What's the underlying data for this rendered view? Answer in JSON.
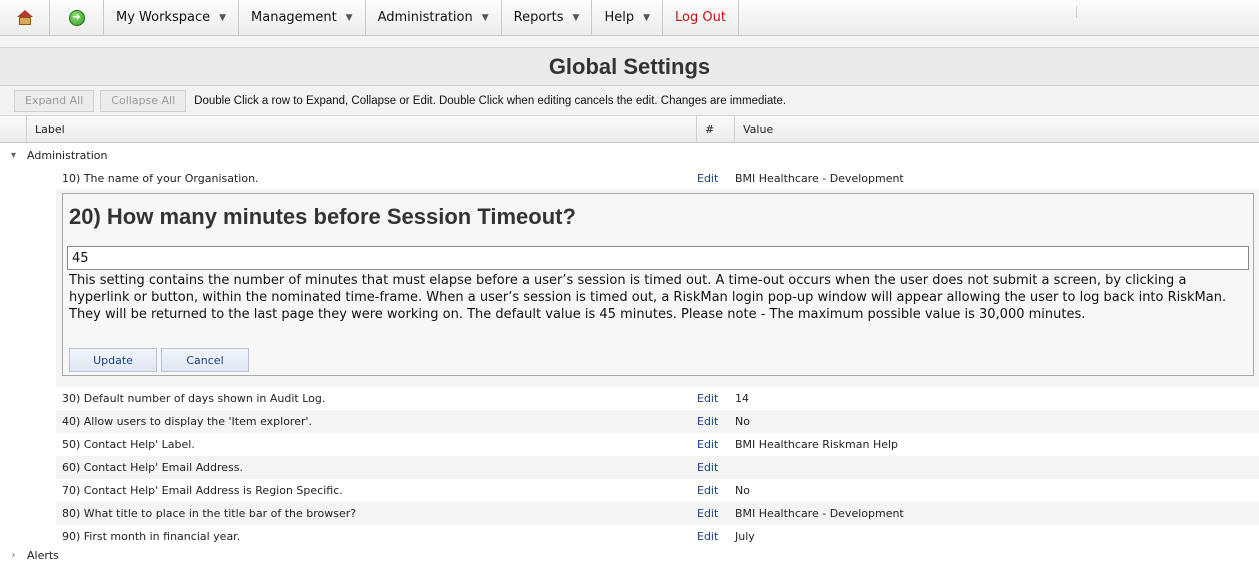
{
  "menu": {
    "items": [
      {
        "label": "My Workspace"
      },
      {
        "label": "Management"
      },
      {
        "label": "Administration"
      },
      {
        "label": "Reports"
      },
      {
        "label": "Help"
      }
    ],
    "logout": "Log Out"
  },
  "page": {
    "title": "Global Settings"
  },
  "toolbar": {
    "expand_all": "Expand All",
    "collapse_all": "Collapse All",
    "instructions": "Double Click a row to Expand, Collapse or Edit. Double Click when editing cancels the edit. Changes are immediate."
  },
  "grid": {
    "columns": {
      "label": "Label",
      "num": "#",
      "value": "Value"
    },
    "groups": [
      {
        "name": "Administration",
        "expanded": true
      },
      {
        "name": "Alerts",
        "expanded": false
      }
    ],
    "rows": [
      {
        "label": "10) The name of your Organisation.",
        "edit": "Edit",
        "value": "BMI Healthcare - Development"
      },
      {
        "label": "30) Default number of days shown in Audit Log.",
        "edit": "Edit",
        "value": "14"
      },
      {
        "label": "40) Allow users to display the 'Item explorer'.",
        "edit": "Edit",
        "value": "No"
      },
      {
        "label": "50) Contact Help' Label.",
        "edit": "Edit",
        "value": "BMI Healthcare Riskman Help"
      },
      {
        "label": "60) Contact Help' Email Address.",
        "edit": "Edit",
        "value": ""
      },
      {
        "label": "70) Contact Help' Email Address is Region Specific.",
        "edit": "Edit",
        "value": "No"
      },
      {
        "label": "80) What title to place in the title bar of the browser?",
        "edit": "Edit",
        "value": "BMI Healthcare - Development"
      },
      {
        "label": "90) First month in financial year.",
        "edit": "Edit",
        "value": "July"
      }
    ]
  },
  "editor": {
    "title": "20) How many minutes before Session Timeout?",
    "value": "45",
    "description": "This setting contains the number of minutes that must elapse before a user’s session is timed out. A time-out occurs when the user does not submit a screen, by clicking a hyperlink or button, within the nominated time-frame. When a user’s session is timed out, a RiskMan login pop-up window will appear allowing the user to log back into RiskMan. They will be returned to the last page they were working on. The default value is 45 minutes. Please note - The maximum possible value is 30,000 minutes.",
    "update_label": "Update",
    "cancel_label": "Cancel"
  }
}
